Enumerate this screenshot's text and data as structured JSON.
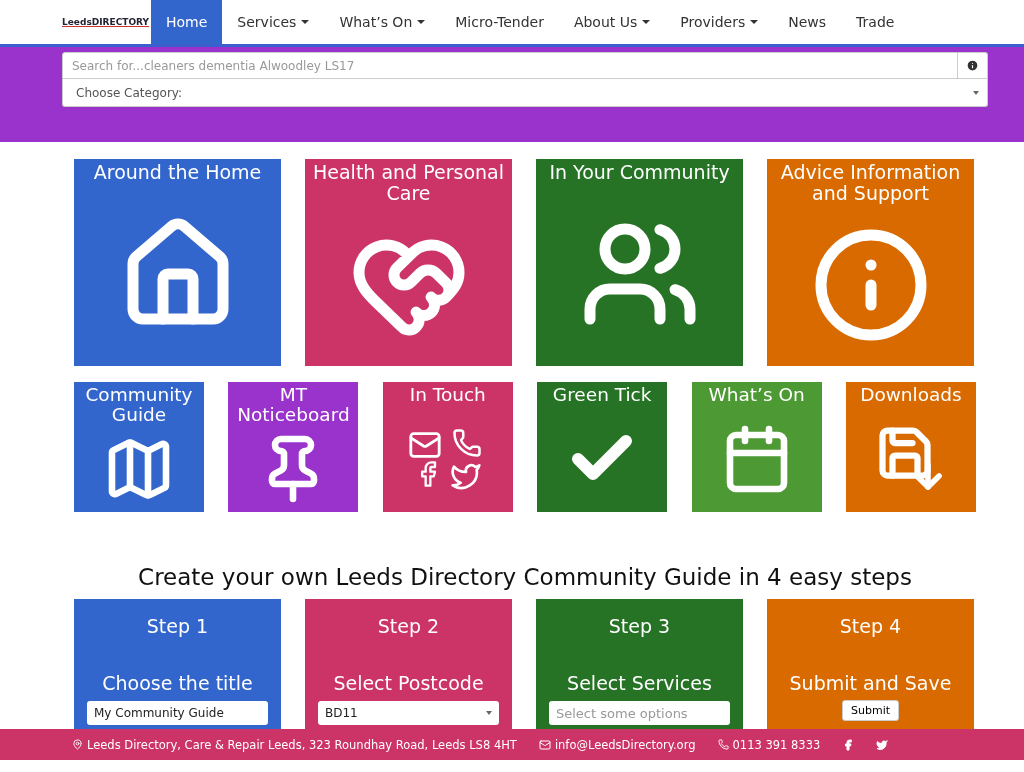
{
  "logo": {
    "text": "LeedsDIRECTORY"
  },
  "nav": [
    {
      "label": "Home",
      "selected": true,
      "dropdown": false
    },
    {
      "label": "Services",
      "selected": false,
      "dropdown": true
    },
    {
      "label": "What’s On",
      "selected": false,
      "dropdown": true
    },
    {
      "label": "Micro-Tender",
      "selected": false,
      "dropdown": false
    },
    {
      "label": "About Us",
      "selected": false,
      "dropdown": true
    },
    {
      "label": "Providers",
      "selected": false,
      "dropdown": true
    },
    {
      "label": "News",
      "selected": false,
      "dropdown": false
    },
    {
      "label": "Trade",
      "selected": false,
      "dropdown": false
    }
  ],
  "search": {
    "placeholder": "Search for...cleaners dementia Alwoodley LS17",
    "category": "Choose Category:"
  },
  "main_tiles": [
    {
      "title": "Around the Home",
      "color": "#3366cc",
      "kind": "house"
    },
    {
      "title": "Health and Personal Care",
      "color": "#cc3366",
      "kind": "care"
    },
    {
      "title": "In Your Community",
      "color": "#267326",
      "kind": "people"
    },
    {
      "title": "Advice Information and Support",
      "color": "#d96a00",
      "kind": "info"
    }
  ],
  "small_tiles": [
    {
      "title": "Community Guide",
      "color": "#3366cc",
      "kind": "map"
    },
    {
      "title": "MT Noticeboard",
      "color": "#9933cc",
      "kind": "pin"
    },
    {
      "title": "In Touch",
      "color": "#cc3366",
      "kind": "contact"
    },
    {
      "title": "Green Tick",
      "color": "#267326",
      "kind": "tick"
    },
    {
      "title": "What’s On",
      "color": "#4d9933",
      "kind": "calendar"
    },
    {
      "title": "Downloads",
      "color": "#d96a00",
      "kind": "download"
    }
  ],
  "steps_heading": "Create your own Leeds Directory Community Guide in 4 easy steps",
  "steps": [
    {
      "title": "Step 1",
      "subtitle": "Choose the title",
      "color": "#3366cc",
      "kind": "text",
      "value": "My Community Guide"
    },
    {
      "title": "Step 2",
      "subtitle": "Select Postcode",
      "color": "#cc3366",
      "kind": "select",
      "value": "BD11"
    },
    {
      "title": "Step 3",
      "subtitle": "Select Services",
      "color": "#267326",
      "kind": "multi",
      "placeholder": "Select some options"
    },
    {
      "title": "Step 4",
      "subtitle": "Submit and Save",
      "color": "#d96a00",
      "kind": "button",
      "value": "Submit"
    }
  ],
  "footer": {
    "address": "Leeds Directory, Care & Repair Leeds, 323 Roundhay Road, Leeds LS8 4HT",
    "email": "info@LeedsDirectory.org",
    "phone": "0113 391 8333"
  }
}
